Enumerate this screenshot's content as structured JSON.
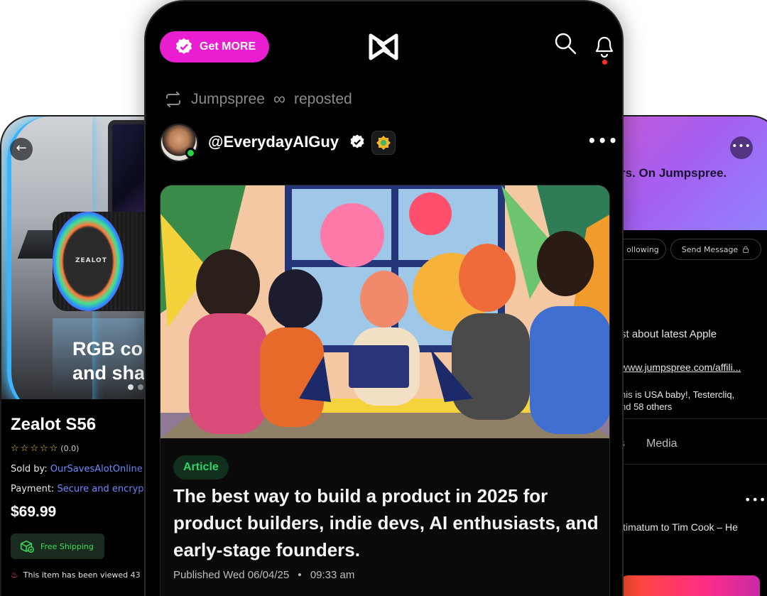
{
  "left_phone": {
    "hero_text": "RGB col\nand sha",
    "speaker_brand": "ZEALOT",
    "product_title": "Zealot S56",
    "rating_count": "(0.0)",
    "sold_by_label": "Sold by:",
    "sold_by_value": "OurSavesAlotOnline",
    "payment_label": "Payment:",
    "payment_value": "Secure and encrypt",
    "price": "$69.99",
    "free_shipping": "Free Shipping",
    "viewed_text": "This item has been viewed 43"
  },
  "center_phone": {
    "get_more_label": "Get MORE",
    "repost": {
      "name": "Jumpspree",
      "symbol": "∞",
      "action": "reposted"
    },
    "author": {
      "handle": "@EverydayAIGuy"
    },
    "post": {
      "tag": "Article",
      "title": "The best way to build a product in 2025 for product builders, indie devs, AI enthusiasts, and early-stage founders.",
      "published_label": "Published",
      "date": "Wed 06/04/25",
      "separator": "•",
      "time": "09:33 am"
    }
  },
  "right_phone": {
    "banner_text": "rs. On Jumpspree.",
    "follow_label": "ollowing",
    "message_label": "Send Message",
    "bio": "st about latest Apple",
    "bio_icon": "",
    "bio_link": "www.jumpspree.com/affili...",
    "liked_by": "his is USA baby!, Testercliq,\nnd 58 others",
    "tabs": [
      "s",
      "Media"
    ],
    "post_text": "ltimatum to Tim Cook – He"
  },
  "colors": {
    "accent_pink": "#e81ed0",
    "link_blue": "#6f8cff",
    "green": "#2fd36a",
    "star": "#f2c94c"
  }
}
